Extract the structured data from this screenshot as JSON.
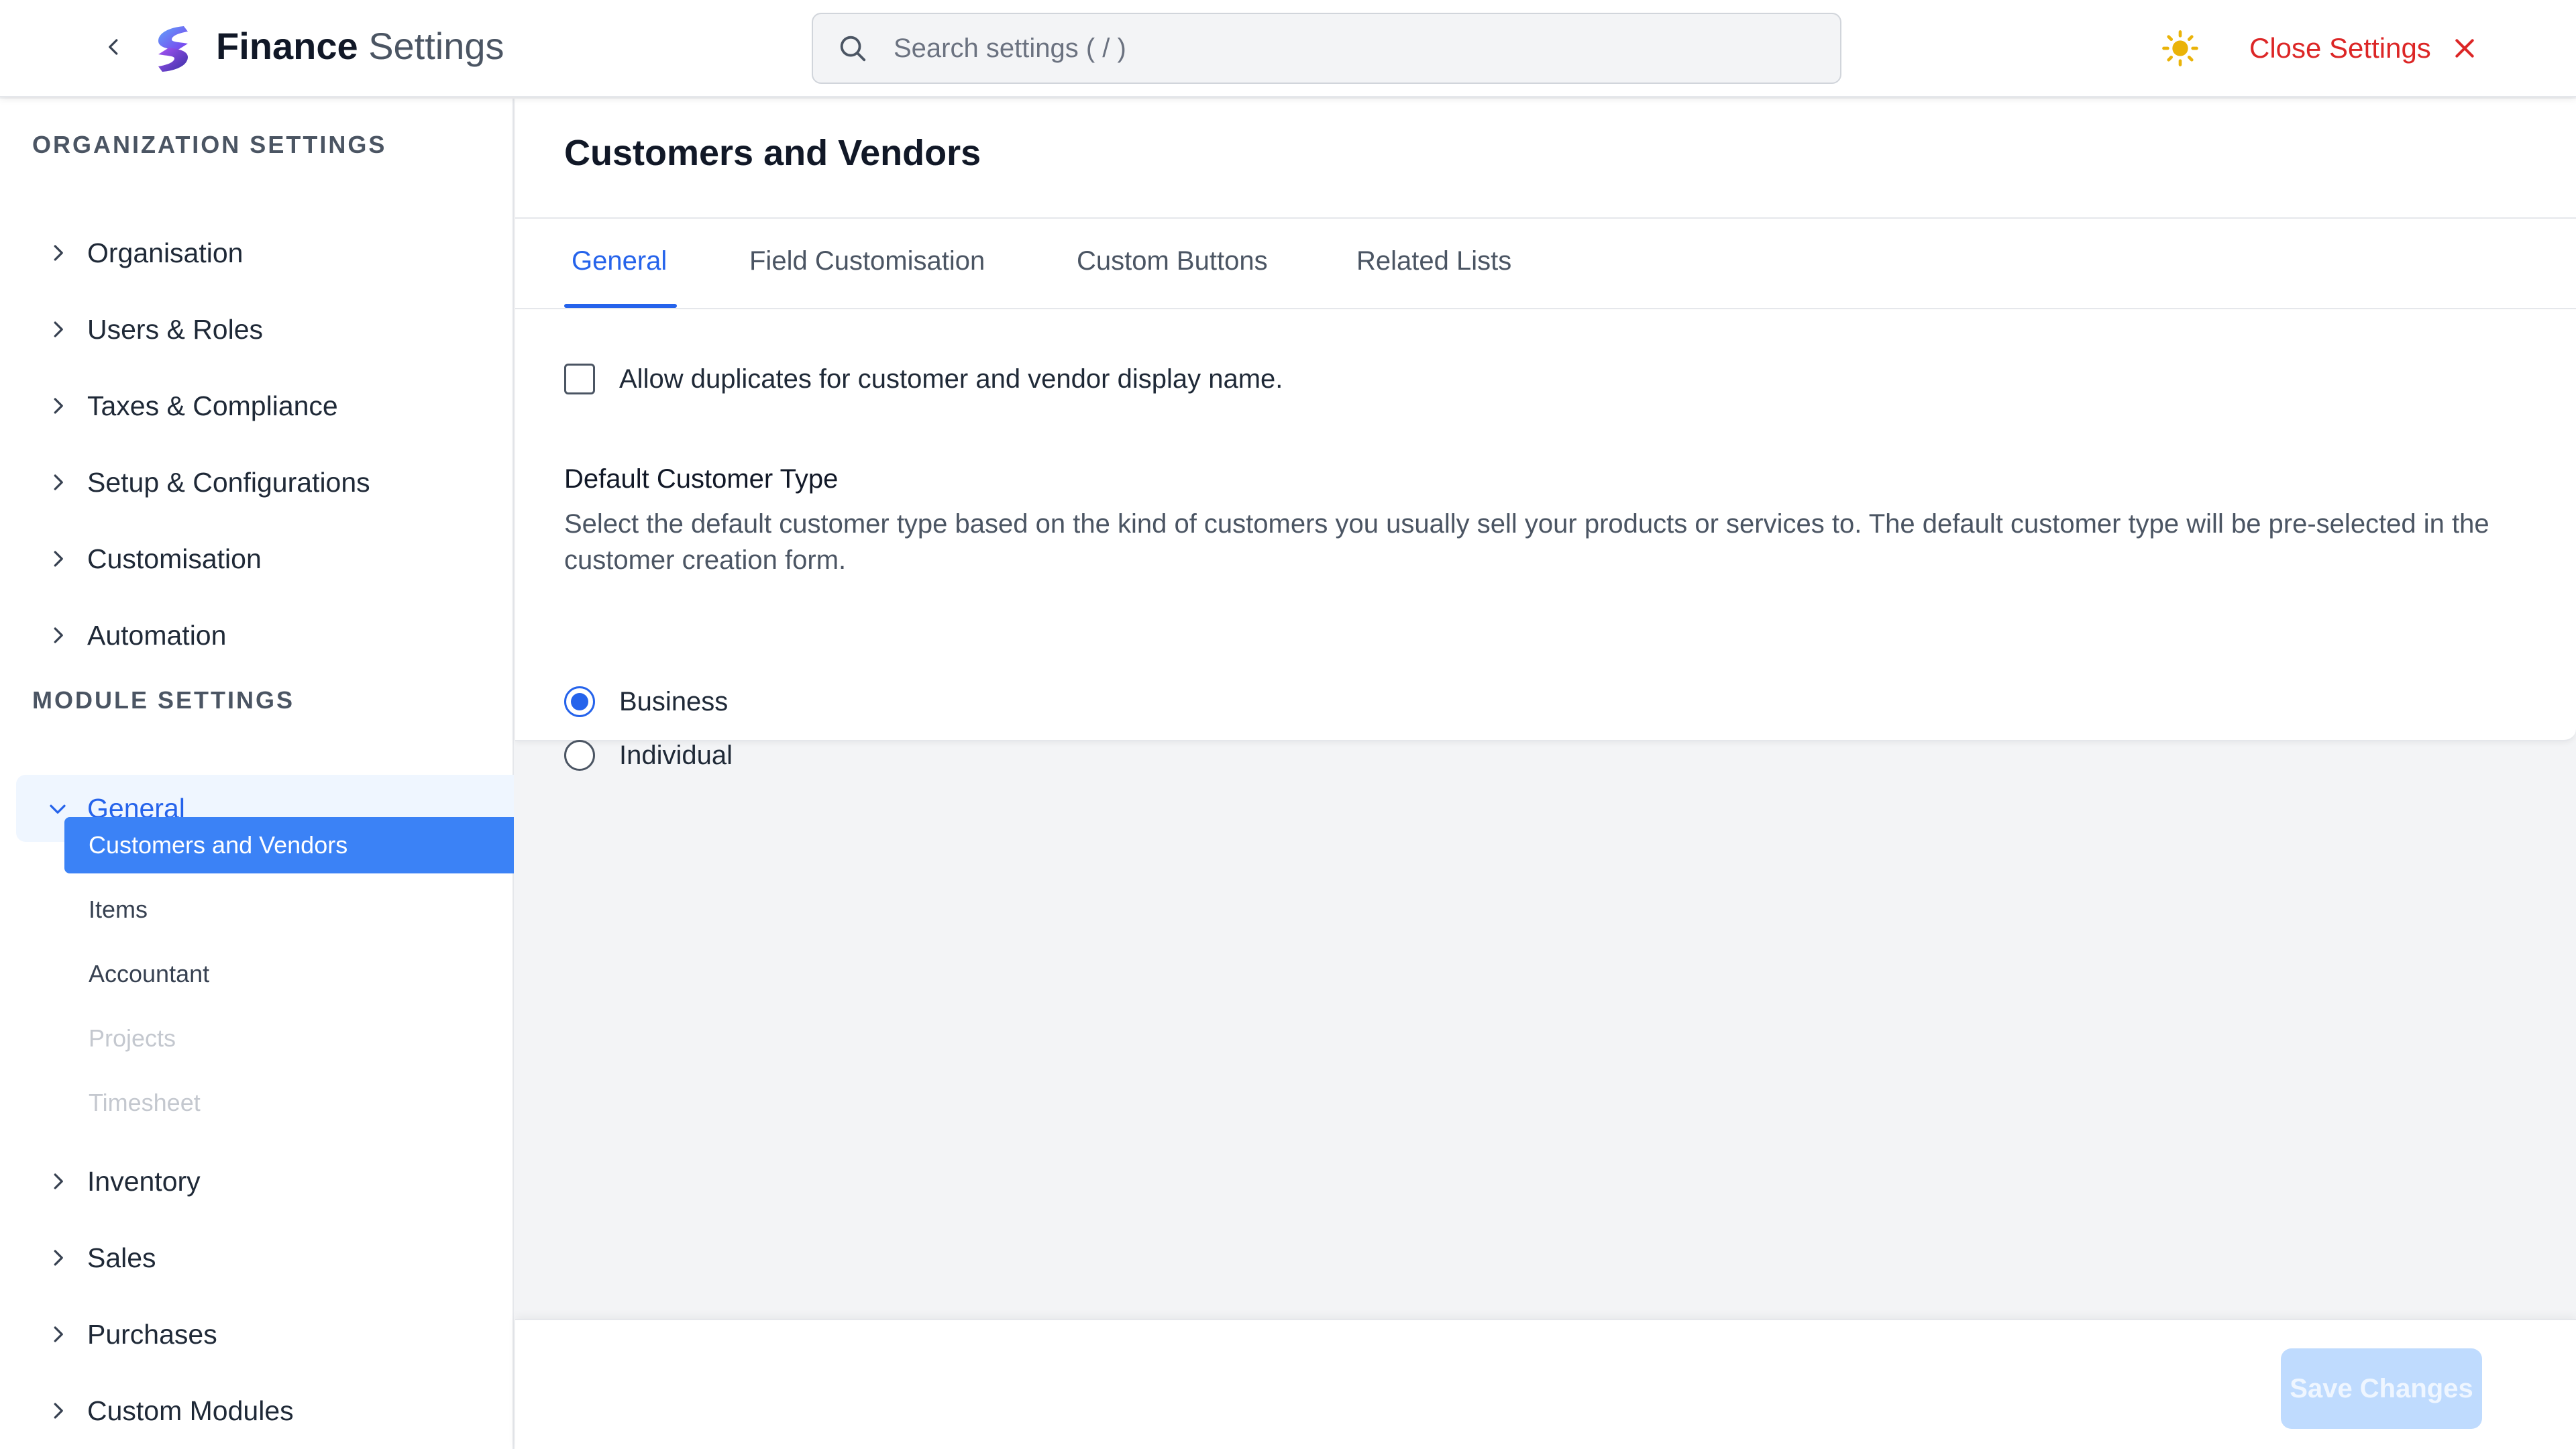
{
  "header": {
    "app_title_strong": "Finance",
    "app_title_light": "Settings",
    "search_placeholder": "Search settings ( / )",
    "close_label": "Close Settings",
    "colors": {
      "accent": "#2563eb",
      "close": "#dc2626",
      "sun": "#eab308"
    }
  },
  "sidebar": {
    "org_section_title": "ORGANIZATION SETTINGS",
    "org_items": [
      {
        "label": "Organisation"
      },
      {
        "label": "Users & Roles"
      },
      {
        "label": "Taxes & Compliance"
      },
      {
        "label": "Setup & Configurations"
      },
      {
        "label": "Customisation"
      },
      {
        "label": "Automation"
      }
    ],
    "module_section_title": "MODULE SETTINGS",
    "general": {
      "label": "General",
      "sub_items": [
        {
          "label": "Customers and Vendors",
          "state": "active"
        },
        {
          "label": "Items",
          "state": "normal"
        },
        {
          "label": "Accountant",
          "state": "normal"
        },
        {
          "label": "Projects",
          "state": "disabled"
        },
        {
          "label": "Timesheet",
          "state": "disabled"
        }
      ]
    },
    "module_items": [
      {
        "label": "Inventory"
      },
      {
        "label": "Sales"
      },
      {
        "label": "Purchases"
      },
      {
        "label": "Custom Modules"
      }
    ]
  },
  "main": {
    "page_title": "Customers and Vendors",
    "tabs": [
      {
        "label": "General",
        "active": true
      },
      {
        "label": "Field Customisation",
        "active": false
      },
      {
        "label": "Custom Buttons",
        "active": false
      },
      {
        "label": "Related Lists",
        "active": false
      }
    ],
    "allow_duplicates": {
      "label": "Allow duplicates for customer and vendor display name.",
      "checked": false
    },
    "default_customer_type": {
      "title": "Default Customer Type",
      "description": "Select the default customer type based on the kind of customers you usually sell your products or services to. The default customer type will be pre-selected in the customer creation form.",
      "options": [
        {
          "label": "Business",
          "selected": true
        },
        {
          "label": "Individual",
          "selected": false
        }
      ]
    }
  },
  "footer": {
    "save_label": "Save Changes"
  }
}
